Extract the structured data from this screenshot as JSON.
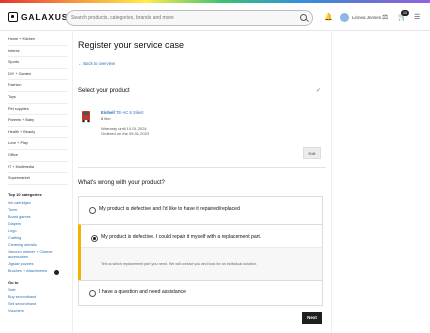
{
  "header": {
    "logo_text": "GALAXUS",
    "search_placeholder": "Search products, categories, brands and more",
    "user_name": "Linnea Jensen",
    "cart_count": "10"
  },
  "sidebar": {
    "categories": [
      "Home + Kitchen",
      "Interior",
      "Sports",
      "DIY + Garden",
      "Fashion",
      "Toys",
      "Pet supplies",
      "Parents + Baby",
      "Health + Beauty",
      "Love + Play",
      "Office",
      "IT + Multimedia",
      "Supermarket"
    ],
    "top_title": "Top 10 categories",
    "top": [
      "Ink cartridges",
      "Toner",
      "Board games",
      "Diapers",
      "Lego",
      "Crafting",
      "Cleaning utensils",
      "Vacuum cleaner + Cleaner accessories",
      "Jigsaw puzzles",
      "Brushes + Attachments"
    ],
    "goto_title": "Go to",
    "goto": [
      "Sale",
      "Buy secondhand",
      "Sell secondhand",
      "Vouchers"
    ]
  },
  "main": {
    "title": "Register your service case",
    "back_link": "Back to overview",
    "select_product_title": "Select your product",
    "product": {
      "brand": "Einhell",
      "model": "TE-AC 6 Silent",
      "variant": "8 liter",
      "warranty": "Warranty until 10.01.2024",
      "ordered": "Ordered on the 09.01.2023"
    },
    "edit_label": "Edit",
    "question": "What's wrong with your product?",
    "options": [
      {
        "label": "My product is defective and I'd like to have it repaired/replaced"
      },
      {
        "label": "My product is defective. I could repair it myself with a replacement part.",
        "description": "Tell us which replacement part you need. We will contact you and look for an individual solution."
      },
      {
        "label": "I have a question and need assistance"
      }
    ],
    "next_label": "Next"
  }
}
